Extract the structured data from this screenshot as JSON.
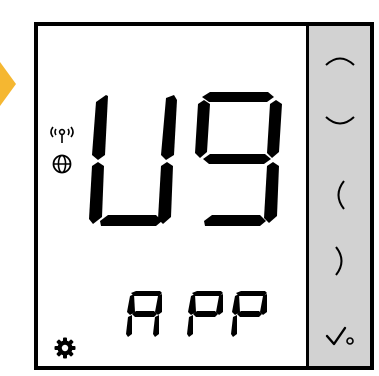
{
  "display": {
    "main_text": "U9",
    "sub_text": "A PP"
  },
  "status_icons": {
    "wireless": "wireless-signal-icon",
    "globe": "globe-icon",
    "settings": "gear-icon"
  },
  "buttons": [
    {
      "id": "up",
      "icon": "chevron-up-icon"
    },
    {
      "id": "down",
      "icon": "chevron-down-icon"
    },
    {
      "id": "left",
      "icon": "chevron-left-icon"
    },
    {
      "id": "right",
      "icon": "chevron-right-icon"
    },
    {
      "id": "confirm",
      "icon": "checkmark-icon"
    }
  ],
  "colors": {
    "pointer": "#f5b731",
    "panel": "#d2d2d2",
    "segment": "#000000"
  }
}
